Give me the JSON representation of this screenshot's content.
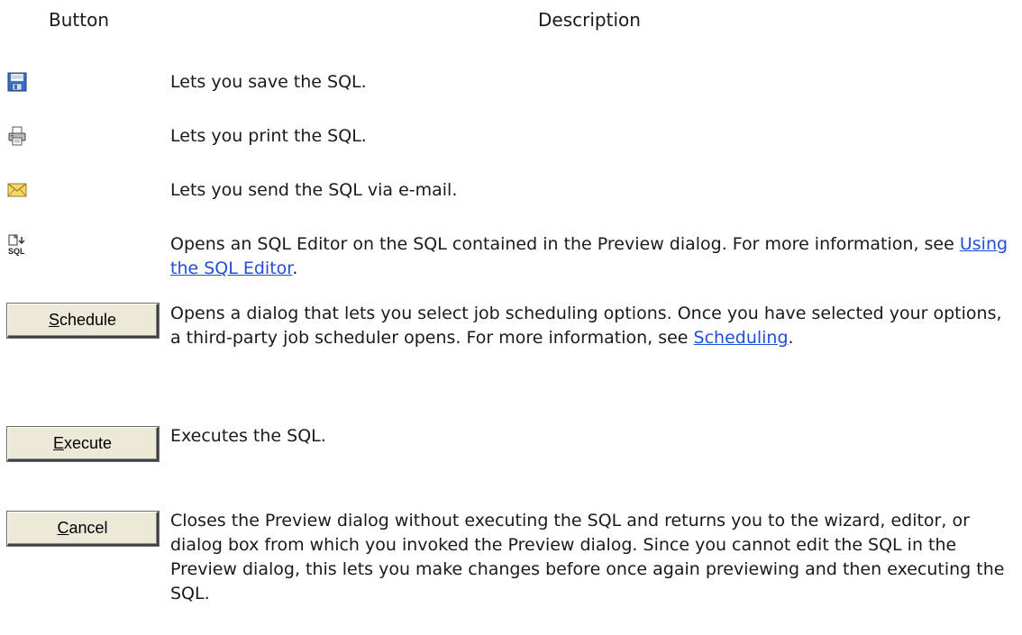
{
  "table": {
    "headers": {
      "button": "Button",
      "description": "Description"
    },
    "rows": [
      {
        "icon": "save-icon",
        "description": "Lets you save the SQL."
      },
      {
        "icon": "print-icon",
        "description": "Lets you print the SQL."
      },
      {
        "icon": "mail-icon",
        "description": "Lets you send the SQL via e-mail."
      },
      {
        "icon": "sql-editor-icon",
        "description_pre": "Opens an SQL Editor on the SQL contained in the Preview dialog. For more information, see ",
        "link": "Using the SQL Editor",
        "description_post": "."
      },
      {
        "button": {
          "accel": "S",
          "rest": "chedule"
        },
        "description_pre": "Opens a dialog that lets you select job scheduling options. Once you have selected your options, a third-party job scheduler opens. For more information, see ",
        "link": "Scheduling",
        "description_post": "."
      },
      {
        "button": {
          "accel": "E",
          "rest": "xecute"
        },
        "description": "Executes the SQL."
      },
      {
        "button": {
          "accel": "C",
          "rest": "ancel"
        },
        "description": "Closes the Preview dialog without executing the SQL and returns you to the wizard, editor, or dialog box from which you invoked the Preview dialog. Since you cannot edit the SQL in the Preview dialog, this lets you make changes before once again previewing and then executing the SQL."
      }
    ]
  },
  "colors": {
    "link": "#1f4fd6",
    "text": "#1a1a1a",
    "button_face": "#ece9d8"
  }
}
